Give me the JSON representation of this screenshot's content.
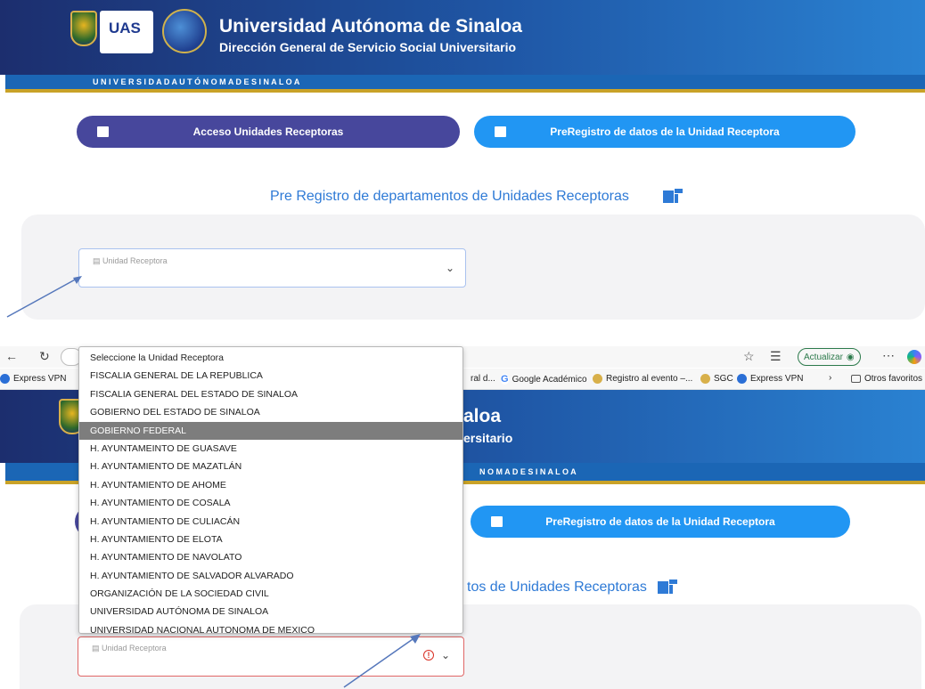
{
  "university": {
    "name": "Universidad Autónoma de Sinaloa",
    "department": "Dirección General de Servicio Social Universitario",
    "stripe_text": "U   N   I   V   E   R   S   I   D   A   D         A   U   T   Ó   N   O   M   A         D   E         S   I   N   A   L   O   A",
    "logo_text": "UAS"
  },
  "nav": {
    "access_label": "Acceso Unidades Receptoras",
    "preregistro_label": "PreRegistro de datos de la Unidad Receptora"
  },
  "section": {
    "title": "Pre Registro de departamentos de Unidades Receptoras",
    "title_partial": "tos de Unidades Receptoras"
  },
  "form": {
    "field_label": "Unidad Receptora",
    "options": [
      "Seleccione la Unidad Receptora",
      "FISCALIA GENERAL DE LA REPUBLICA",
      "FISCALIA GENERAL DEL ESTADO DE SINALOA",
      "GOBIERNO DEL ESTADO DE SINALOA",
      "GOBIERNO FEDERAL",
      "H. AYUNTAMEINTO DE GUASAVE",
      "H. AYUNTAMIENTO DE MAZATLÁN",
      "H. AYUNTAMIENTO DE AHOME",
      "H. AYUNTAMIENTO DE COSALA",
      "H. AYUNTAMIENTO DE CULIACÁN",
      "H. AYUNTAMIENTO DE ELOTA",
      "H. AYUNTAMIENTO DE NAVOLATO",
      "H. AYUNTAMIENTO DE SALVADOR ALVARADO",
      "ORGANIZACIÓN DE LA SOCIEDAD CIVIL",
      "UNIVERSIDAD AUTÓNOMA DE SINALOA",
      "UNIVERSIDAD NACIONAL AUTONOMA DE MEXICO"
    ],
    "highlighted_option": "GOBIERNO FEDERAL"
  },
  "browser": {
    "update_label": "Actualizar",
    "bookmarks": {
      "express_vpn_left": "Express VPN",
      "partial": "ral d...",
      "google_academico": "Google Académico",
      "registro": "Registro al evento –...",
      "sgc": "SGC",
      "express_vpn_right": "Express VPN",
      "otros": "Otros favoritos"
    }
  },
  "banner_partial": {
    "title_tail": "aloa",
    "sub_tail": "ersitario",
    "stripe_tail": "N    O    M    A          D    E          S    I    N    A    L    O    A"
  },
  "colors": {
    "banner_dark": "#1c2e6e",
    "banner_light": "#2a82d2",
    "pill_dark": "#47479c",
    "pill_light": "#2196f3",
    "title_blue": "#2e7ad6",
    "gold": "#c9a227",
    "error_red": "#e06666"
  }
}
